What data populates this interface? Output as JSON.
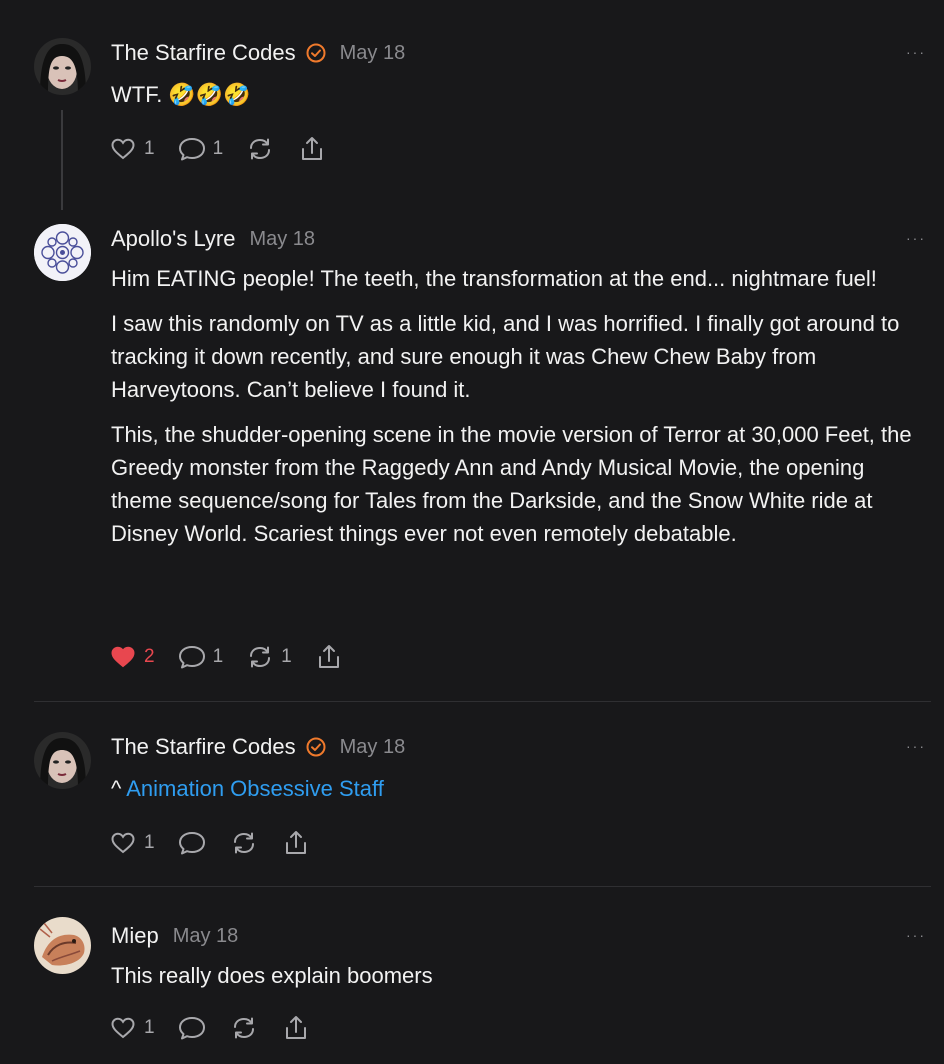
{
  "comments": [
    {
      "author": "The Starfire Codes",
      "date": "May 18",
      "text": "WTF. 🤣🤣🤣",
      "likes": "1",
      "replies": "1",
      "restacks": "",
      "more": "···"
    },
    {
      "author": "Apollo's Lyre",
      "date": "May 18",
      "paragraphs": [
        "Him EATING people! The teeth, the transformation at the end... nightmare fuel!",
        "I saw this randomly on TV as a little kid, and I was horrified. I finally got around to tracking it down recently, and sure enough it was Chew Chew Baby from Harveytoons. Can’t believe I found it.",
        "This, the shudder-opening scene in the movie version of Terror at 30,000 Feet, the Greedy monster from the Raggedy Ann and Andy Musical Movie, the opening theme sequence/song for Tales from the Darkside, and the Snow White ride at Disney World. Scariest things ever not even remotely debatable."
      ],
      "likes": "2",
      "replies": "1",
      "restacks": "1",
      "more": "···"
    },
    {
      "author": "The Starfire Codes",
      "date": "May 18",
      "prefix": "^ ",
      "link_text": "Animation Obsessive Staff",
      "likes": "1",
      "more": "···"
    },
    {
      "author": "Miep",
      "date": "May 18",
      "text": "This really does explain boomers",
      "likes": "1",
      "more": "···"
    }
  ],
  "colors": {
    "accent_badge": "#f07a2c",
    "liked": "#e8474f",
    "link": "#2f9df0"
  }
}
